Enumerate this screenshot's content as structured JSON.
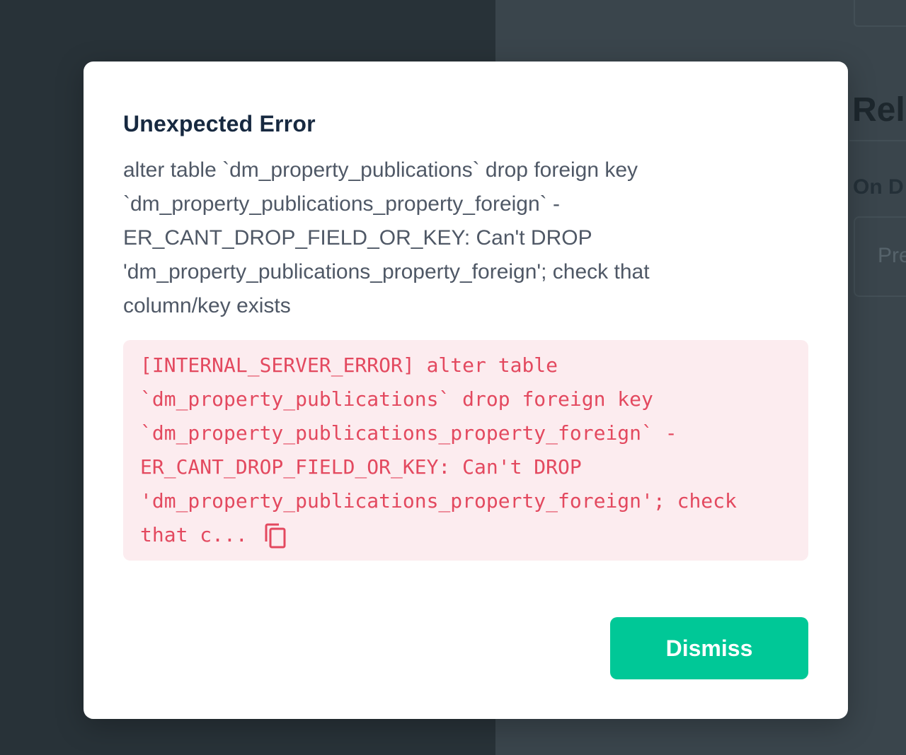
{
  "background": {
    "heading": "Rela",
    "label": "On D",
    "input_placeholder": "Pre"
  },
  "modal": {
    "title": "Unexpected Error",
    "message": "alter table `dm_property_publications` drop foreign key `dm_property_publications_property_foreign` - ER_CANT_DROP_FIELD_OR_KEY: Can't DROP 'dm_property_publications_property_foreign'; check that column/key exists",
    "error_details": "[INTERNAL_SERVER_ERROR] alter table\n`dm_property_publications` drop foreign key\n`dm_property_publications_property_foreign` -\nER_CANT_DROP_FIELD_OR_KEY: Can't DROP\n'dm_property_publications_property_foreign'; check\nthat c...",
    "copy_icon": "copy-icon",
    "dismiss_label": "Dismiss"
  },
  "colors": {
    "accent": "#00c897",
    "error_text": "#e3495f",
    "error_bg": "#fcecef",
    "title": "#172940"
  }
}
